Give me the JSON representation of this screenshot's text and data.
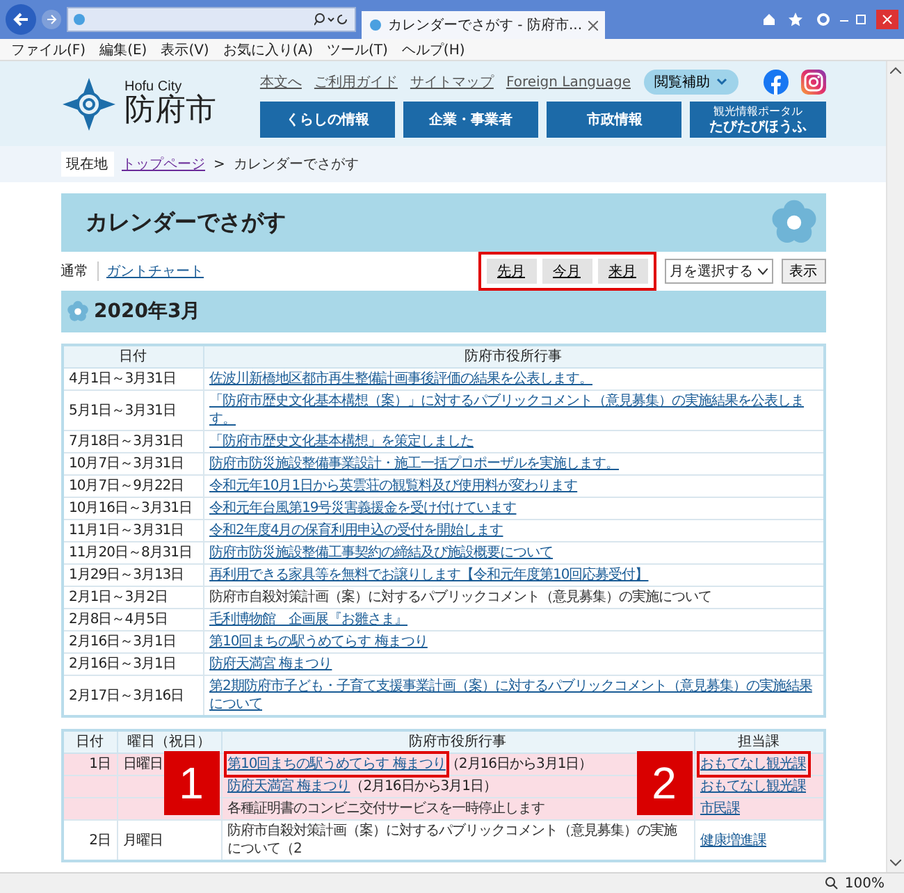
{
  "browser": {
    "tab_title": "カレンダーでさがす - 防府市...",
    "menu": [
      "ファイル(F)",
      "編集(E)",
      "表示(V)",
      "お気に入り(A)",
      "ツール(T)",
      "ヘルプ(H)"
    ],
    "zoom": "100%"
  },
  "header": {
    "city_en": "Hofu City",
    "city_ja": "防府市",
    "links": [
      "本文へ",
      "ご利用ガイド",
      "サイトマップ",
      "Foreign Language"
    ],
    "assist_button": "閲覧補助",
    "nav": [
      {
        "label": "くらしの情報"
      },
      {
        "label": "企業・事業者"
      },
      {
        "label": "市政情報"
      },
      {
        "small": "観光情報ポータル",
        "label": "たびたびほうふ"
      }
    ]
  },
  "breadcrumb": {
    "here": "現在地",
    "items": [
      {
        "label": "トップページ",
        "link": true
      },
      {
        "label": "カレンダーでさがす",
        "link": false
      }
    ],
    "separator": ">"
  },
  "page_title": "カレンダーでさがす",
  "view_tabs": [
    {
      "label": "通常",
      "selected": true
    },
    {
      "label": "ガントチャート",
      "selected": false
    }
  ],
  "month_nav": {
    "buttons": [
      "先月",
      "今月",
      "来月"
    ],
    "highlighted": true
  },
  "month_select": {
    "value": "月を選択する"
  },
  "show_button": "表示",
  "month_heading": "2020年3月",
  "events_table": {
    "columns": [
      "日付",
      "防府市役所行事"
    ],
    "rows": [
      {
        "date": "4月1日～3月31日",
        "event": "佐波川新橋地区都市再生整備計画事後評価の結果を公表します。",
        "link": true
      },
      {
        "date": "5月1日～3月31日",
        "event": "「防府市歴史文化基本構想（案）」に対するパブリックコメント（意見募集）の実施結果を公表します。",
        "link": true
      },
      {
        "date": "7月18日～3月31日",
        "event": "「防府市歴史文化基本構想」を策定しました",
        "link": true
      },
      {
        "date": "10月7日～3月31日",
        "event": "防府市防災施設整備事業設計・施工一括プロポーザルを実施します。",
        "link": true
      },
      {
        "date": "10月7日～9月22日",
        "event": "令和元年10月1日から英雲荘の観覧料及び使用料が変わります",
        "link": true
      },
      {
        "date": "10月16日～3月31日",
        "event": "令和元年台風第19号災害義援金を受け付けています",
        "link": true
      },
      {
        "date": "11月1日～3月31日",
        "event": "令和2年度4月の保育利用申込の受付を開始します",
        "link": true
      },
      {
        "date": "11月20日～8月31日",
        "event": "防府市防災施設整備工事契約の締結及び施設概要について",
        "link": true
      },
      {
        "date": "1月29日～3月13日",
        "event": "再利用できる家具等を無料でお譲りします【令和元年度第10回応募受付】",
        "link": true
      },
      {
        "date": "2月1日～3月2日",
        "event": "防府市自殺対策計画（案）に対するパブリックコメント（意見募集）の実施について",
        "link": false
      },
      {
        "date": "2月8日～4月5日",
        "event": "毛利博物館　企画展『お雛さま』",
        "link": true
      },
      {
        "date": "2月16日～3月1日",
        "event": "第10回まちの駅うめてらす 梅まつり",
        "link": true
      },
      {
        "date": "2月16日～3月1日",
        "event": "防府天満宮 梅まつり",
        "link": true
      },
      {
        "date": "2月17日～3月16日",
        "event": "第2期防府市子ども・子育て支援事業計画（案）に対するパブリックコメント（意見募集）の実施結果について",
        "link": true
      }
    ]
  },
  "day_table": {
    "columns": [
      "日付",
      "曜日（祝日）",
      "防府市役所行事",
      "担当課"
    ],
    "rows": [
      {
        "day": "1日",
        "weekday": "日曜日",
        "highlighted": true,
        "event": "第10回まちの駅うめてらす 梅まつり",
        "event_link": true,
        "note": "（2月16日から3月1日）",
        "dept": "おもてなし観光課",
        "event_callout": "1",
        "dept_callout": "2"
      },
      {
        "highlighted": true,
        "event": "防府天満宮 梅まつり",
        "event_link": true,
        "note": "（2月16日から3月1日）",
        "dept": "おもてなし観光課"
      },
      {
        "highlighted": true,
        "event": "各種証明書のコンビニ交付サービスを一時停止します",
        "event_link": false,
        "dept": "市民課"
      },
      {
        "day": "2日",
        "weekday": "月曜日",
        "highlighted": false,
        "event": "防府市自殺対策計画（案）に対するパブリックコメント（意見募集）の実施について（2",
        "event_link": false,
        "dept": "健康増進課"
      }
    ]
  }
}
